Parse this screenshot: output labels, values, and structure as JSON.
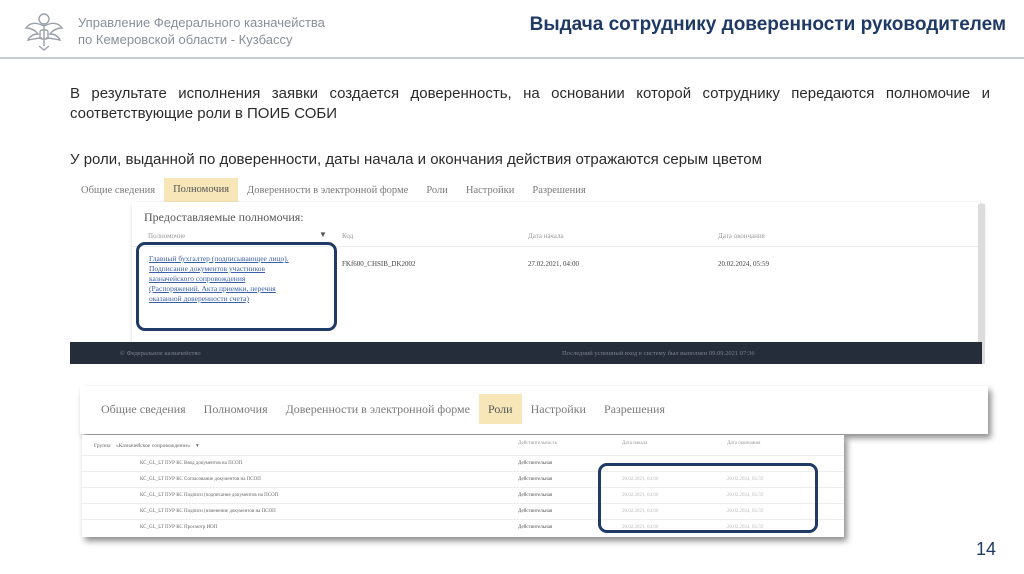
{
  "header": {
    "org_line1": "Управление Федерального казначейства",
    "org_line2": "по Кемеровской области - Кузбассу",
    "slide_title": "Выдача сотруднику доверенности руководителем"
  },
  "body": {
    "paragraph1": "В результате исполнения заявки создается доверенность, на основании которой сотруднику передаются полномочие и соответствующие роли в ПОИБ СОБИ",
    "paragraph2": "У роли, выданной по доверенности, даты начала и окончания действия отражаются серым цветом"
  },
  "screenshot1": {
    "tabs": [
      "Общие сведения",
      "Полномочия",
      "Доверенности в электронной форме",
      "Роли",
      "Настройки",
      "Разрешения"
    ],
    "active_tab": "Полномочия",
    "section_title": "Предоставляемые полномочия:",
    "columns": [
      "Полномочие",
      "Код",
      "Дата начала",
      "Дата окончания"
    ],
    "row": {
      "link_lines": [
        "Главный бухгалтер (подписывающее лицо).",
        "Подписание документов участников",
        "казначейского сопровождения",
        "(Распоряжений. Акта приемки, перечня",
        "оказанной доверенности счета)"
      ],
      "code": "FKf600_CHSIB_DK2002",
      "start": "27.02.2021, 04:00",
      "end": "20.02.2024, 05:59"
    },
    "footer_left": "© Федеральное казначейство",
    "footer_right": "Последний успешный вход в систему был выполнен 09.09.2021 07:36"
  },
  "screenshot2": {
    "tabs": [
      "Общие сведения",
      "Полномочия",
      "Доверенности в электронной форме",
      "Роли",
      "Настройки",
      "Разрешения"
    ],
    "active_tab": "Роли"
  },
  "screenshot3": {
    "group_label": "Группа",
    "group_value": "«Казначейское сопровождение»",
    "columns": [
      "Действительность",
      "Дата начала",
      "Дата окончания"
    ],
    "rows": [
      {
        "name": "КС_GL_LT ПУР КС Ввод документов на ПСОП",
        "status": "Действительная",
        "start": "",
        "end": ""
      },
      {
        "name": "КС_GL_LT ПУР КС Согласование документов на ПСОП",
        "status": "Действительная",
        "start": "20.02.2021, 04:00",
        "end": "20.02.2024, 05:59"
      },
      {
        "name": "КС_GL_LT ПУР КС Подписи (подписание документов на ПСОП",
        "status": "Действительная",
        "start": "20.02.2021, 04:00",
        "end": "20.02.2024, 05:59"
      },
      {
        "name": "КС_GL_LT ПУР КС Подписи (изменение документов на ПСОП",
        "status": "Действительная",
        "start": "20.02.2021, 04:00",
        "end": "20.02.2024, 05:59"
      },
      {
        "name": "КС_GL_LT ПУР КС Просмотр ИОП",
        "status": "Действительная",
        "start": "20.02.2021, 04:00",
        "end": "20.02.2024, 05:59"
      }
    ]
  },
  "slide_number": "14",
  "colors": {
    "title": "#1f3a64",
    "highlight": "#1f3a64",
    "active_tab": "#f6e6b8",
    "footer_bar": "#262d3a"
  }
}
